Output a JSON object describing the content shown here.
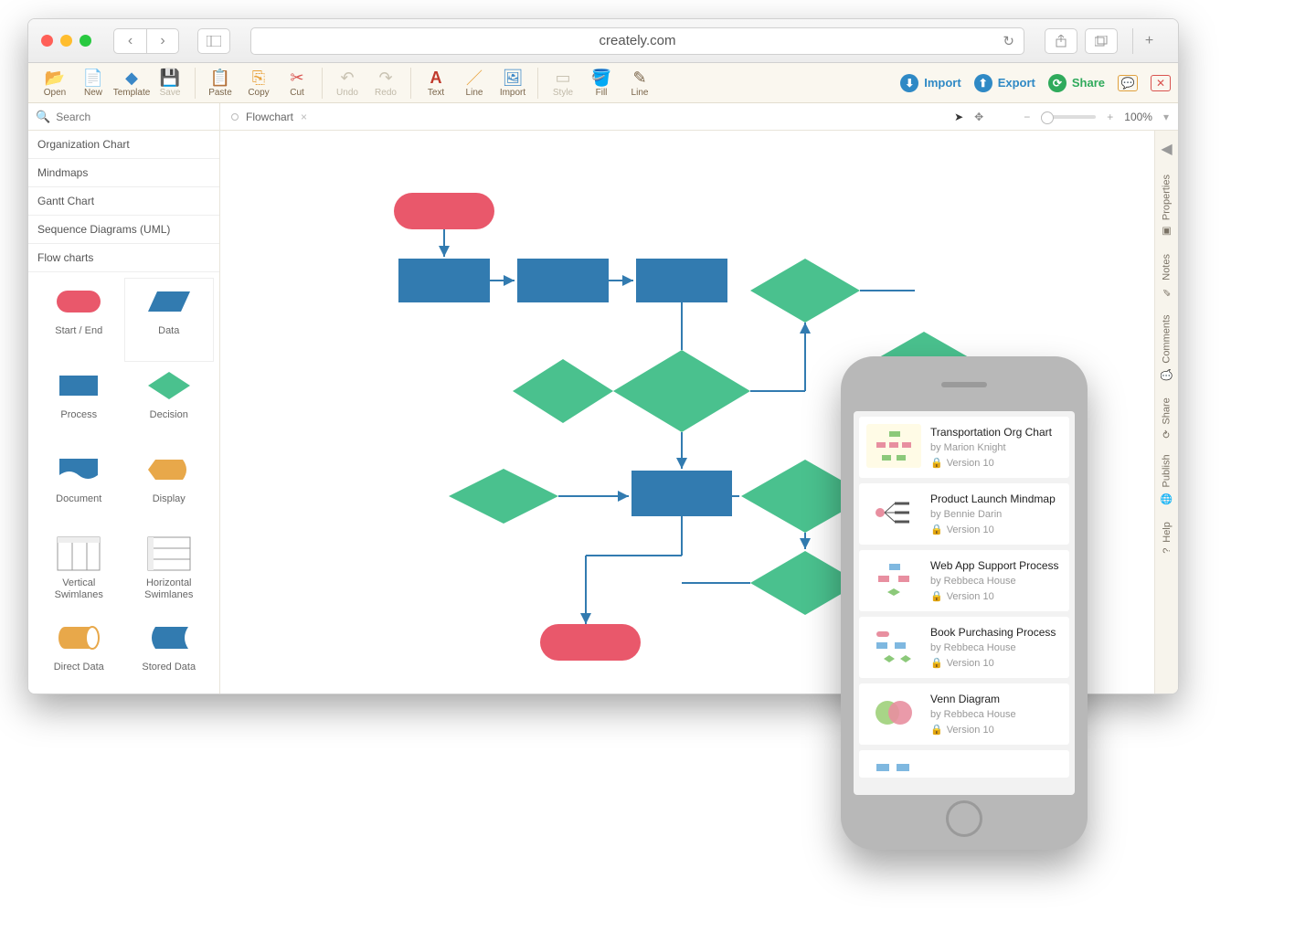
{
  "browser": {
    "url": "creately.com"
  },
  "toolbar": {
    "open": "Open",
    "new": "New",
    "template": "Template",
    "save": "Save",
    "paste": "Paste",
    "copy": "Copy",
    "cut": "Cut",
    "undo": "Undo",
    "redo": "Redo",
    "text": "Text",
    "line": "Line",
    "import_img": "Import",
    "style": "Style",
    "fill": "Fill",
    "line2": "Line",
    "import": "Import",
    "export": "Export",
    "share": "Share"
  },
  "search": {
    "placeholder": "Search"
  },
  "tab": {
    "name": "Flowchart"
  },
  "zoom": {
    "value": "100%"
  },
  "categories": [
    "Organization Chart",
    "Mindmaps",
    "Gantt Chart",
    "Sequence Diagrams (UML)",
    "Flow charts"
  ],
  "shapes": [
    {
      "label": "Start / End"
    },
    {
      "label": "Data"
    },
    {
      "label": "Process"
    },
    {
      "label": "Decision"
    },
    {
      "label": "Document"
    },
    {
      "label": "Display"
    },
    {
      "label": "Vertical Swimlanes"
    },
    {
      "label": "Horizontal Swimlanes"
    },
    {
      "label": "Direct Data"
    },
    {
      "label": "Stored Data"
    }
  ],
  "rside": [
    "Properties",
    "Notes",
    "Comments",
    "Share",
    "Publish",
    "Help"
  ],
  "phone": {
    "items": [
      {
        "title": "Transportation Org Chart",
        "by": "by Marion Knight",
        "ver": "Version 10"
      },
      {
        "title": "Product Launch Mindmap",
        "by": "by Bennie Darin",
        "ver": "Version 10"
      },
      {
        "title": "Web App Support Process",
        "by": "by Rebbeca House",
        "ver": "Version 10"
      },
      {
        "title": "Book Purchasing Process",
        "by": "by Rebbeca House",
        "ver": "Version 10"
      },
      {
        "title": "Venn Diagram",
        "by": "by Rebbeca House",
        "ver": "Version 10"
      }
    ]
  }
}
